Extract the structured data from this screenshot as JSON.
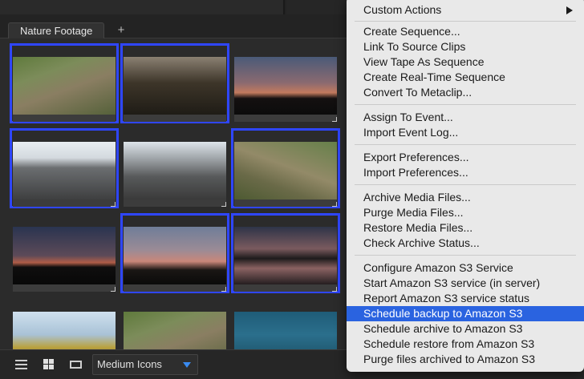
{
  "panel": {
    "tab_label": "Nature Footage",
    "add_tab_symbol": "+"
  },
  "grid": {
    "cells": [
      {
        "thumb": "tortoise",
        "selected": true
      },
      {
        "thumb": "cactus-silhouette",
        "selected": true
      },
      {
        "thumb": "sunset-cactus",
        "selected": false
      },
      {
        "thumb": "lava-rocks",
        "selected": true
      },
      {
        "thumb": "lava-rocks-closeup",
        "selected": false
      },
      {
        "thumb": "tortoise",
        "selected": true
      },
      {
        "thumb": "dusk-silhouette",
        "selected": false
      },
      {
        "thumb": "dusk-silhouette",
        "selected": true
      },
      {
        "thumb": "sunset-reflection",
        "selected": true
      },
      {
        "thumb": "yellow-flowers",
        "selected": false
      },
      {
        "thumb": "tortoise",
        "selected": false
      },
      {
        "thumb": "underwater",
        "selected": false
      }
    ]
  },
  "toolbar": {
    "view_mode": "Medium Icons",
    "list_view_icon": "list-icon",
    "grid_view_icon": "grid-icon",
    "filmstrip_view_icon": "filmstrip-icon"
  },
  "context_menu": {
    "highlight_color": "#2a63e0",
    "items": [
      {
        "label": "Custom Actions",
        "submenu": true
      },
      {
        "label": "Create Sequence..."
      },
      {
        "label": "Link To Source Clips"
      },
      {
        "label": "View Tape As Sequence"
      },
      {
        "label": "Create Real-Time Sequence"
      },
      {
        "label": "Convert To Metaclip..."
      },
      {
        "label": "Assign To Event..."
      },
      {
        "label": "Import Event Log..."
      },
      {
        "label": "Export Preferences..."
      },
      {
        "label": "Import Preferences..."
      },
      {
        "label": "Archive Media Files..."
      },
      {
        "label": "Purge Media Files..."
      },
      {
        "label": "Restore Media Files..."
      },
      {
        "label": "Check Archive Status..."
      },
      {
        "label": "Configure Amazon S3 Service"
      },
      {
        "label": "Start Amazon S3 service (in server)"
      },
      {
        "label": "Report Amazon S3 service status"
      },
      {
        "label": "Schedule backup to Amazon S3",
        "highlighted": true
      },
      {
        "label": "Schedule archive to Amazon S3"
      },
      {
        "label": "Schedule restore from Amazon S3"
      },
      {
        "label": "Purge files archived to Amazon S3"
      }
    ]
  }
}
